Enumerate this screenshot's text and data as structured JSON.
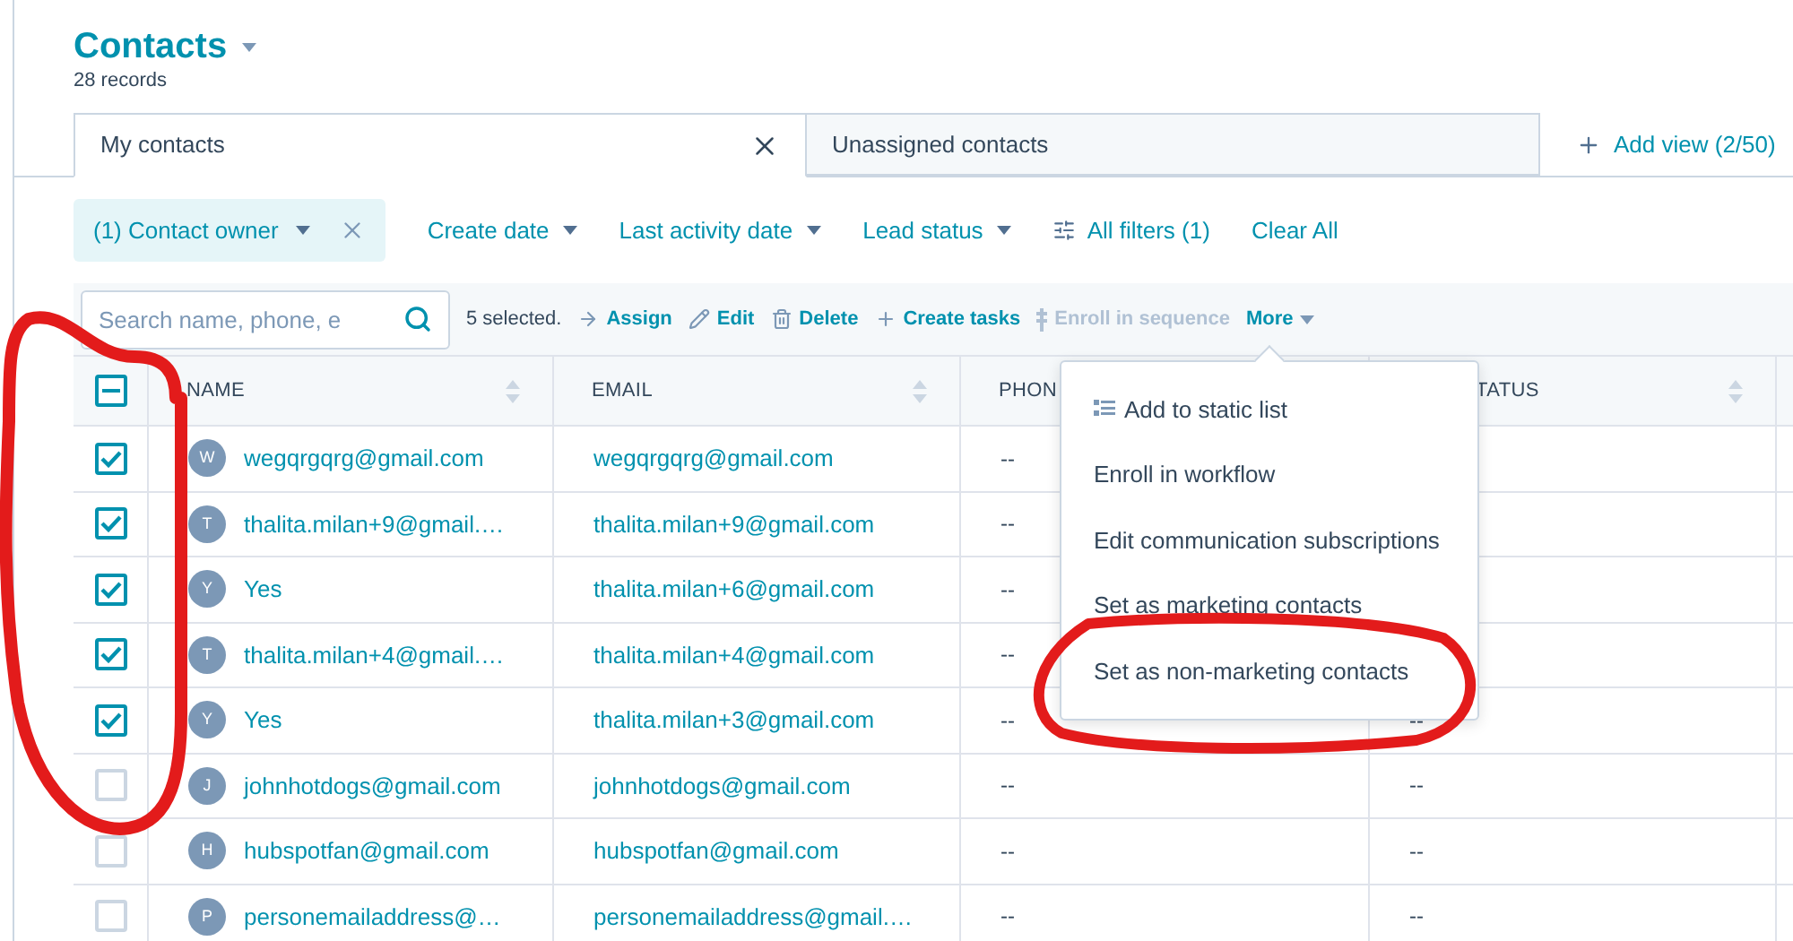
{
  "title": "Contacts",
  "record_count": "28 records",
  "views": [
    {
      "label": "My contacts",
      "selected": true,
      "closable": true
    },
    {
      "label": "Unassigned contacts",
      "selected": false,
      "closable": false
    }
  ],
  "add_view": "Add view (2/50)",
  "filters": [
    {
      "label": "(1) Contact owner",
      "kind": "active"
    },
    {
      "label": "Create date",
      "kind": "dropdown"
    },
    {
      "label": "Last activity date",
      "kind": "dropdown"
    },
    {
      "label": "Lead status",
      "kind": "dropdown"
    },
    {
      "label": "All filters (1)",
      "kind": "all"
    },
    {
      "label": "Clear All",
      "kind": "link"
    }
  ],
  "search": {
    "placeholder": "Search name, phone, e"
  },
  "selection_count": "5 selected.",
  "bulk_actions": [
    {
      "label": "Assign",
      "kind": "arrow",
      "disabled": false
    },
    {
      "label": "Edit",
      "kind": "pencil",
      "disabled": false
    },
    {
      "label": "Delete",
      "kind": "trash",
      "disabled": false
    },
    {
      "label": "Create tasks",
      "kind": "plus",
      "disabled": false
    },
    {
      "label": "Enroll in sequence",
      "kind": "sequence",
      "disabled": true
    },
    {
      "label": "More",
      "kind": "menu",
      "disabled": false,
      "expanded": true
    }
  ],
  "table": {
    "select_all_partial": true,
    "columns": [
      {
        "label": "NAME",
        "sortable": true
      },
      {
        "label": "EMAIL",
        "sortable": true
      },
      {
        "label": "PHON"
      },
      {
        "label": "TATUS",
        "sortable": true
      }
    ],
    "rows": [
      {
        "selected": true,
        "initial": "W",
        "name": "wegqrgqrg@gmail.com",
        "email": "wegqrgqrg@gmail.com",
        "phone": "--"
      },
      {
        "selected": true,
        "initial": "T",
        "name": "thalita.milan+9@gmail.…",
        "email": "thalita.milan+9@gmail.com",
        "phone": "--"
      },
      {
        "selected": true,
        "initial": "Y",
        "name": "Yes",
        "email": "thalita.milan+6@gmail.com",
        "phone": "--"
      },
      {
        "selected": true,
        "initial": "T",
        "name": "thalita.milan+4@gmail.…",
        "email": "thalita.milan+4@gmail.com",
        "phone": "--"
      },
      {
        "selected": true,
        "initial": "Y",
        "name": "Yes",
        "email": "thalita.milan+3@gmail.com",
        "phone": "--",
        "status": "--"
      },
      {
        "selected": false,
        "initial": "J",
        "name": "johnhotdogs@gmail.com",
        "email": "johnhotdogs@gmail.com",
        "phone": "--",
        "status": "--"
      },
      {
        "selected": false,
        "initial": "H",
        "name": "hubspotfan@gmail.com",
        "email": "hubspotfan@gmail.com",
        "phone": "--",
        "status": "--"
      },
      {
        "selected": false,
        "initial": "P",
        "name": "personemailaddress@…",
        "email": "personemailaddress@gmail.…",
        "phone": "--",
        "status": "--"
      }
    ]
  },
  "more_menu": [
    {
      "label": "Add to static list",
      "kind": "with-icon"
    },
    {
      "label": "Enroll in workflow",
      "kind": "plain"
    },
    {
      "label": "Edit communication subscriptions",
      "kind": "plain"
    },
    {
      "label": "Set as marketing contacts",
      "kind": "plain"
    },
    {
      "label": "Set as non-marketing contacts",
      "kind": "plain"
    }
  ]
}
